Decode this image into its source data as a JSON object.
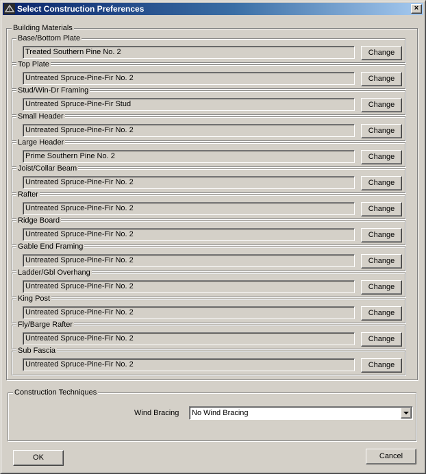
{
  "window": {
    "title": "Select Construction Preferences",
    "close_label": "×"
  },
  "building_materials": {
    "label": "Building Materials",
    "change_label": "Change",
    "items": [
      {
        "label": "Base/Bottom Plate",
        "value": "Treated Southern Pine No. 2"
      },
      {
        "label": "Top Plate",
        "value": "Untreated Spruce-Pine-Fir No. 2"
      },
      {
        "label": "Stud/Win-Dr Framing",
        "value": "Untreated Spruce-Pine-Fir Stud"
      },
      {
        "label": "Small Header",
        "value": "Untreated Spruce-Pine-Fir No. 2"
      },
      {
        "label": "Large Header",
        "value": "Prime Southern Pine No. 2"
      },
      {
        "label": "Joist/Collar Beam",
        "value": "Untreated Spruce-Pine-Fir No. 2"
      },
      {
        "label": "Rafter",
        "value": "Untreated Spruce-Pine-Fir No. 2"
      },
      {
        "label": "Ridge Board",
        "value": "Untreated Spruce-Pine-Fir No. 2"
      },
      {
        "label": "Gable End Framing",
        "value": "Untreated Spruce-Pine-Fir No. 2"
      },
      {
        "label": "Ladder/Gbl Overhang",
        "value": "Untreated Spruce-Pine-Fir No. 2"
      },
      {
        "label": "King Post",
        "value": "Untreated Spruce-Pine-Fir No. 2"
      },
      {
        "label": "Fly/Barge Rafter",
        "value": "Untreated Spruce-Pine-Fir No. 2"
      },
      {
        "label": "Sub Fascia",
        "value": "Untreated Spruce-Pine-Fir No. 2"
      }
    ]
  },
  "construction_techniques": {
    "label": "Construction Techniques",
    "wind_bracing_label": "Wind Bracing",
    "wind_bracing_value": "No Wind Bracing"
  },
  "footer": {
    "ok_label": "OK",
    "cancel_label": "Cancel"
  },
  "colors": {
    "face": "#d4d0c8",
    "title_start": "#0a246a",
    "title_end": "#a6caf0"
  },
  "icons": {
    "app": "app-icon",
    "close": "close-icon",
    "dropdown": "chevron-down-icon"
  }
}
